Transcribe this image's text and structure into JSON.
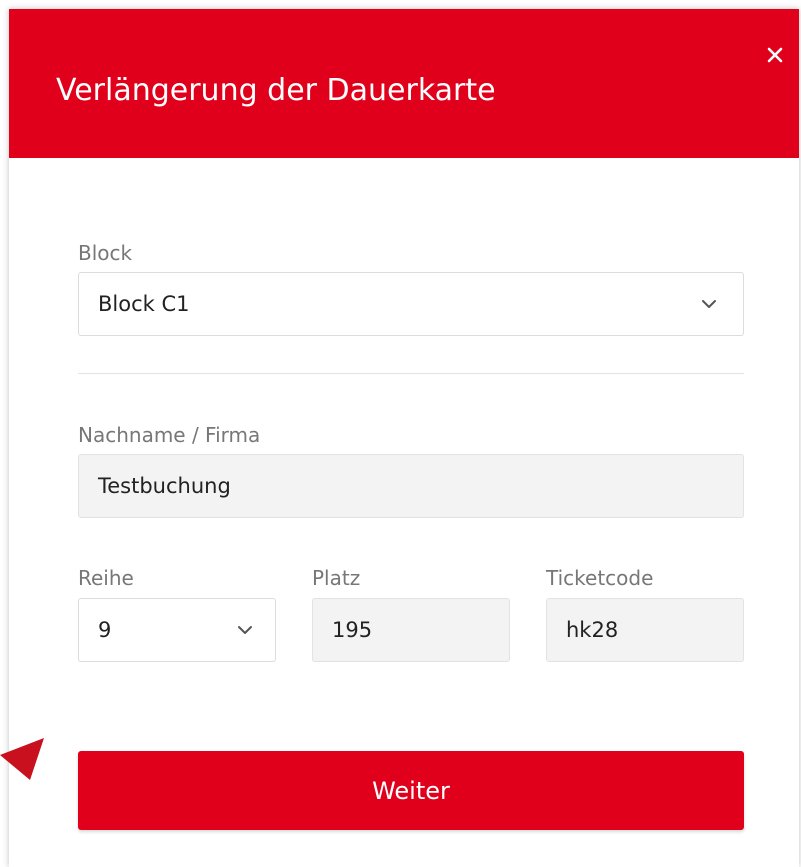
{
  "modal": {
    "title": "Verlängerung der Dauerkarte",
    "close_icon": "close-icon"
  },
  "form": {
    "block": {
      "label": "Block",
      "value": "Block C1"
    },
    "nachname": {
      "label": "Nachname / Firma",
      "value": "Testbuchung"
    },
    "reihe": {
      "label": "Reihe",
      "value": "9"
    },
    "platz": {
      "label": "Platz",
      "value": "195"
    },
    "ticketcode": {
      "label": "Ticketcode",
      "value": "hk28"
    },
    "submit_label": "Weiter"
  },
  "colors": {
    "brand_red": "#e0001b",
    "arrow_red": "#c8101e",
    "input_fill": "#f3f3f3",
    "label_gray": "#777777"
  }
}
